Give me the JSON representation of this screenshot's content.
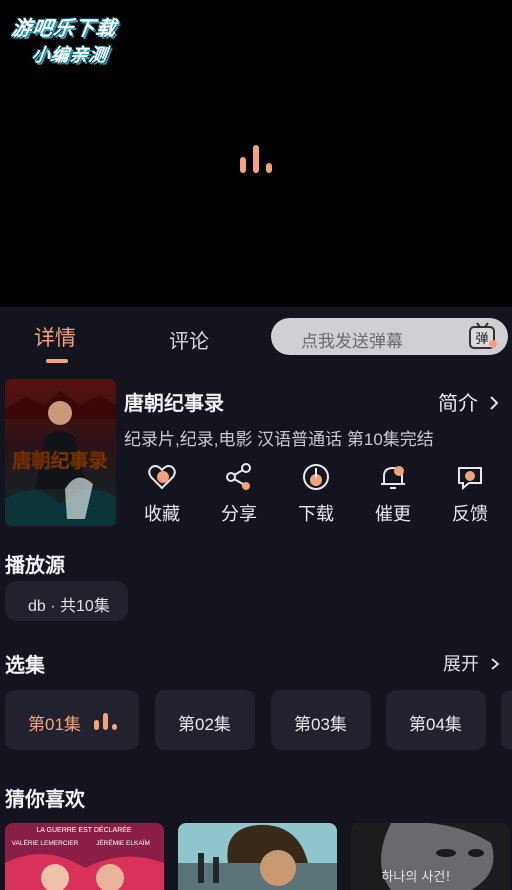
{
  "watermark": {
    "line1": "游吧乐下载",
    "line2": "小编亲测"
  },
  "tabs": [
    {
      "label": "详情",
      "active": true
    },
    {
      "label": "评论",
      "active": false
    }
  ],
  "danmu": {
    "placeholder": "点我发送弹幕",
    "icon_text": "弹"
  },
  "show": {
    "title": "唐朝纪事录",
    "poster_text": "唐朝纪事录",
    "intro_label": "简介",
    "meta": "纪录片,纪录,电影 汉语普通话 第10集完结"
  },
  "actions": [
    {
      "label": "收藏",
      "icon": "heart-icon"
    },
    {
      "label": "分享",
      "icon": "share-icon"
    },
    {
      "label": "下载",
      "icon": "download-icon"
    },
    {
      "label": "催更",
      "icon": "bell-icon"
    },
    {
      "label": "反馈",
      "icon": "feedback-icon"
    }
  ],
  "source": {
    "title": "播放源",
    "chip": "db · 共10集"
  },
  "episodes": {
    "title": "选集",
    "expand_label": "展开",
    "items": [
      {
        "label": "第01集",
        "active": true
      },
      {
        "label": "第02集",
        "active": false
      },
      {
        "label": "第03集",
        "active": false
      },
      {
        "label": "第04集",
        "active": false
      }
    ]
  },
  "recommend": {
    "title": "猜你喜欢",
    "items": [
      {
        "text_top": "LA GUERRE EST DÉCLARÉE",
        "name_left": "VALÉRIE LEMERCIER",
        "name_right": "JÉRÉMIE ELKAÏM"
      },
      {
        "text_top": ""
      },
      {
        "text_top": "하나의 사건!"
      }
    ]
  },
  "colors": {
    "accent": "#f3a27c",
    "panel_bg": "#14141e",
    "chip_bg": "#22222e"
  }
}
